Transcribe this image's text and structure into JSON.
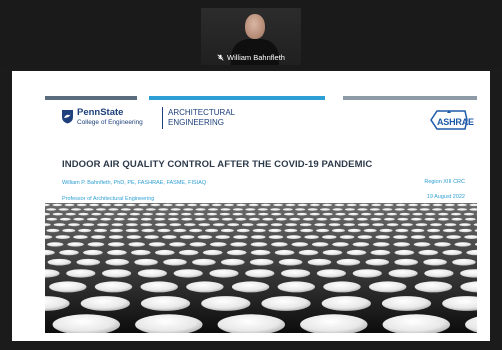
{
  "participant": {
    "name": "William Bahnfleth",
    "mic_icon": "mic-muted-icon"
  },
  "slide": {
    "university_name": "PennState",
    "college_name": "College of Engineering",
    "department_line1": "ARCHITECTURAL",
    "department_line2": "ENGINEERING",
    "partner_logo": "ASHRAE",
    "title": "INDOOR AIR QUALITY CONTROL AFTER THE COVID-19 PANDEMIC",
    "presenter": "William P. Bahnfleth, PhD, PE, FASHRAE, FASME, FISIAQ",
    "role": "Professor of Architectural Engineering",
    "event": "Region XIII CRC",
    "date": "19 August 2022"
  },
  "colors": {
    "psu_blue": "#1e407c",
    "accent_blue": "#2e9fd4",
    "title_text": "#2d3a4a",
    "ashrae_blue": "#1e5aa8",
    "background": "#1b1b1b"
  }
}
